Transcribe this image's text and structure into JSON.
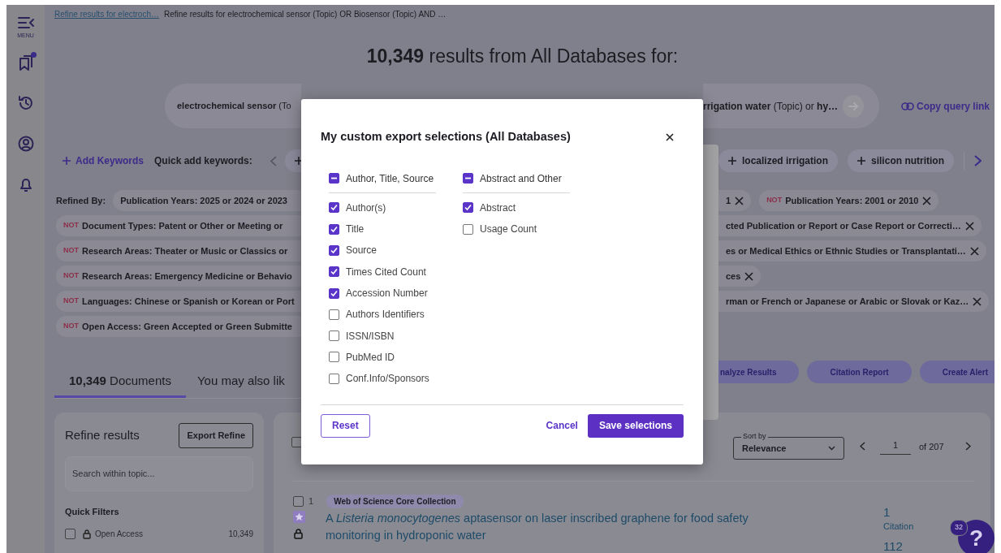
{
  "sidebar": {
    "menu_label": "MENU",
    "items": [
      {
        "kind": "bookmarks",
        "dot": true
      },
      {
        "kind": "history",
        "dot": false
      },
      {
        "kind": "profile",
        "dot": false
      },
      {
        "kind": "alerts",
        "dot": false
      }
    ]
  },
  "breadcrumb": [
    {
      "text": "Refine results for electroch…",
      "link": true
    },
    {
      "text": "Refine results for electrochemical sensor (Topic) OR Biosensor (Topic) AND …",
      "link": false
    }
  ],
  "heading": "**10,349** results from All Databases for:",
  "query": {
    "left": "**electrochemical sensor** (To",
    "right": "**rrigation water** (Topic) or **hy…**",
    "copy_link": "Copy query link"
  },
  "keywords": {
    "add": "Add Keywords",
    "label": "Quick add keywords:",
    "chips": [
      "localized irrigation",
      "silicon nutrition"
    ]
  },
  "refined_by": {
    "label": "Refined By:",
    "rows": [
      {
        "left": {
          "text": "Publication Years: 2025 or 2024 or 2023"
        },
        "right": [
          {
            "text": "1"
          },
          {
            "prefix": "NOT",
            "text": "Publication Years: 2001 or 2010"
          }
        ]
      },
      {
        "left": {
          "prefix": "NOT",
          "text": "Document Types: Patent or Other or Meeting or"
        },
        "right": [
          {
            "text": "cted Publication or Report or Case Report or Correcti…"
          }
        ]
      },
      {
        "left": {
          "prefix": "NOT",
          "text": "Research Areas: Theater or Music or Classics or"
        },
        "right": [
          {
            "text": "es or Medical Ethics or Ethnic Studies or Transplantati…"
          }
        ]
      },
      {
        "left": {
          "prefix": "NOT",
          "text": "Research Areas: Emergency Medicine or Behavio"
        },
        "right": [
          {
            "text": "ces"
          }
        ]
      },
      {
        "left": {
          "prefix": "NOT",
          "text": "Languages: Chinese or Spanish or Korean or Port"
        },
        "right": [
          {
            "text": "rman or French or Japanese or Arabic or Slovak or Kaz…"
          }
        ]
      },
      {
        "left": {
          "prefix": "NOT",
          "text": "Open Access: Green Accepted or Green Submitte"
        },
        "right": []
      }
    ]
  },
  "tabs": [
    {
      "label": "**10,349** Documents",
      "selected": true
    },
    {
      "label": "You may also lik",
      "selected": false
    }
  ],
  "actions": [
    "nalyze Results",
    "Citation Report",
    "Create Alert"
  ],
  "refine_panel": {
    "title": "Refine results",
    "export_button": "Export Refine",
    "search": {
      "placeholder": "Search within topic..."
    },
    "quick_filters": {
      "title": "Quick Filters",
      "items": [
        {
          "label": "Open Access",
          "count": "10,349",
          "checked": false
        }
      ]
    }
  },
  "results": {
    "select_all_checked": false,
    "sort": {
      "label": "Sort by",
      "value": "Relevance"
    },
    "page": {
      "value": "1",
      "of": "of 207"
    },
    "records": [
      {
        "index": "1",
        "checked": false,
        "badge": "Web of Science Core Collection",
        "title": "A *Listeria monocytogenes* aptasensor on laser inscribed graphene for food safety monitoring in hydroponic water",
        "citations": "1",
        "citations_label": "Citation",
        "metric": "112"
      }
    ]
  },
  "help": {
    "label": "?",
    "badge": "32"
  },
  "dialog": {
    "title": "My custom export selections (All Databases)",
    "groups": [
      {
        "label": "Author, Title, Source",
        "indeterminate": true,
        "items": [
          {
            "label": "Author(s)",
            "checked": true
          },
          {
            "label": "Title",
            "checked": true
          },
          {
            "label": "Source",
            "checked": true
          },
          {
            "label": "Times Cited Count",
            "checked": true
          },
          {
            "label": "Accession Number",
            "checked": true
          },
          {
            "label": "Authors Identifiers",
            "checked": false
          },
          {
            "label": "ISSN/ISBN",
            "checked": false
          },
          {
            "label": "PubMed ID",
            "checked": false
          },
          {
            "label": "Conf.Info/Sponsors",
            "checked": false
          }
        ]
      },
      {
        "label": "Abstract and Other",
        "indeterminate": true,
        "items": [
          {
            "label": "Abstract",
            "checked": true
          },
          {
            "label": "Usage Count",
            "checked": false
          }
        ]
      }
    ],
    "reset": "Reset",
    "cancel": "Cancel",
    "save": "Save selections"
  }
}
